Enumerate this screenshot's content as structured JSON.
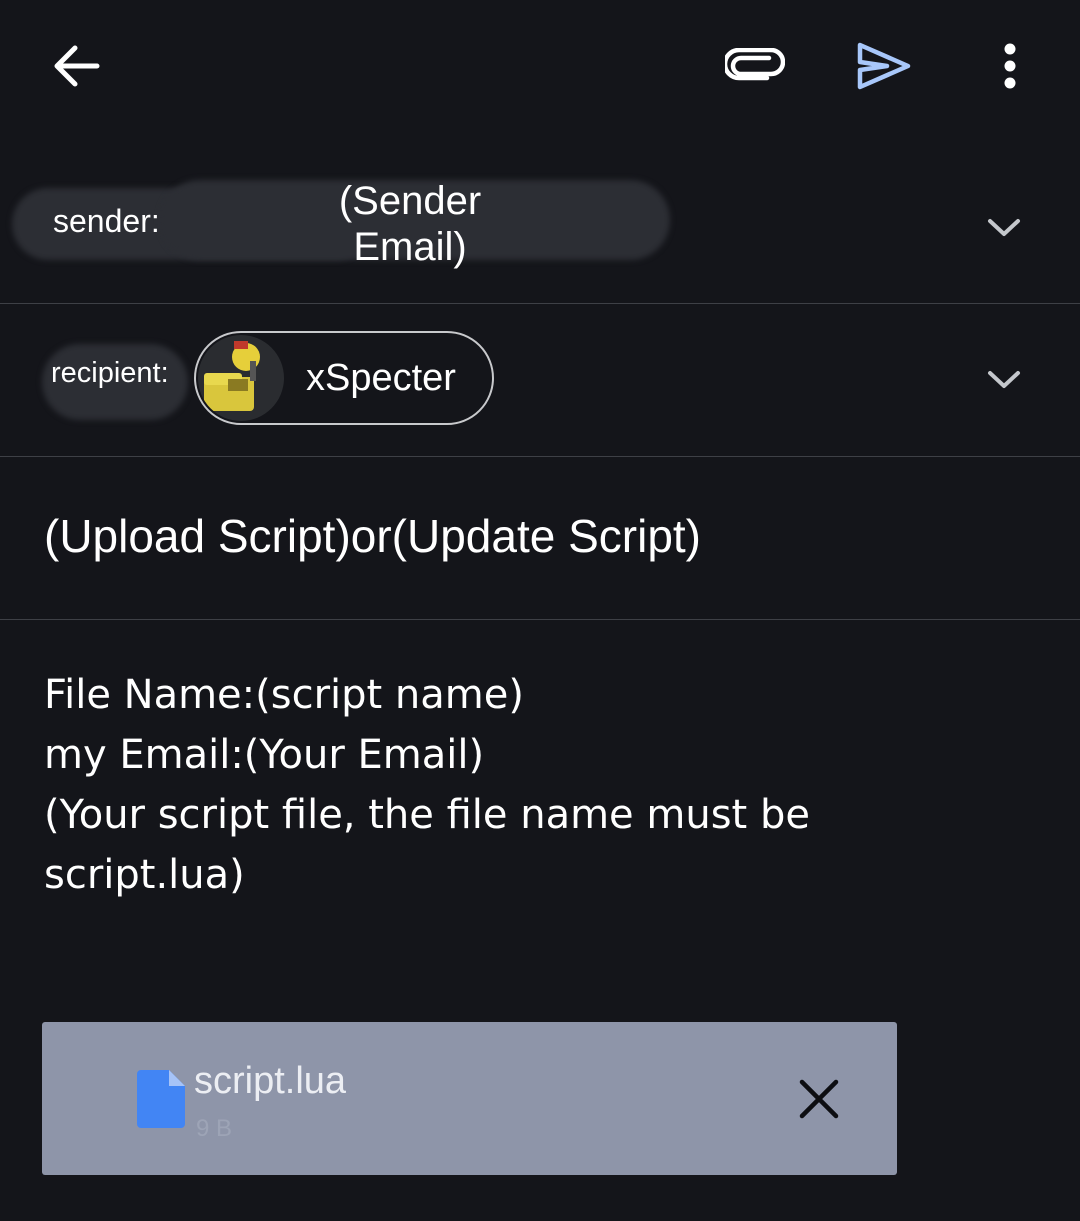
{
  "toolbar": {
    "back_icon": "arrow-left-icon",
    "attach_icon": "paperclip-icon",
    "send_icon": "send-icon",
    "more_icon": "more-vertical-icon",
    "send_color": "#a8c7fa"
  },
  "from": {
    "label": "sender:",
    "email_line1": "(Sender",
    "email_line2": "Email)"
  },
  "to": {
    "label": "recipient:",
    "chip_name": "xSpecter"
  },
  "subject": {
    "value": "(Upload Script)or(Update Script)"
  },
  "body": {
    "lines": [
      "File Name:(script name)",
      "my Email:(Your Email)",
      "(Your script file, the file name must be",
      "script.lua)"
    ]
  },
  "attachment": {
    "name": "script.lua",
    "size": "9 B",
    "file_icon_color": "#4285f4",
    "background": "#8e95a9"
  }
}
